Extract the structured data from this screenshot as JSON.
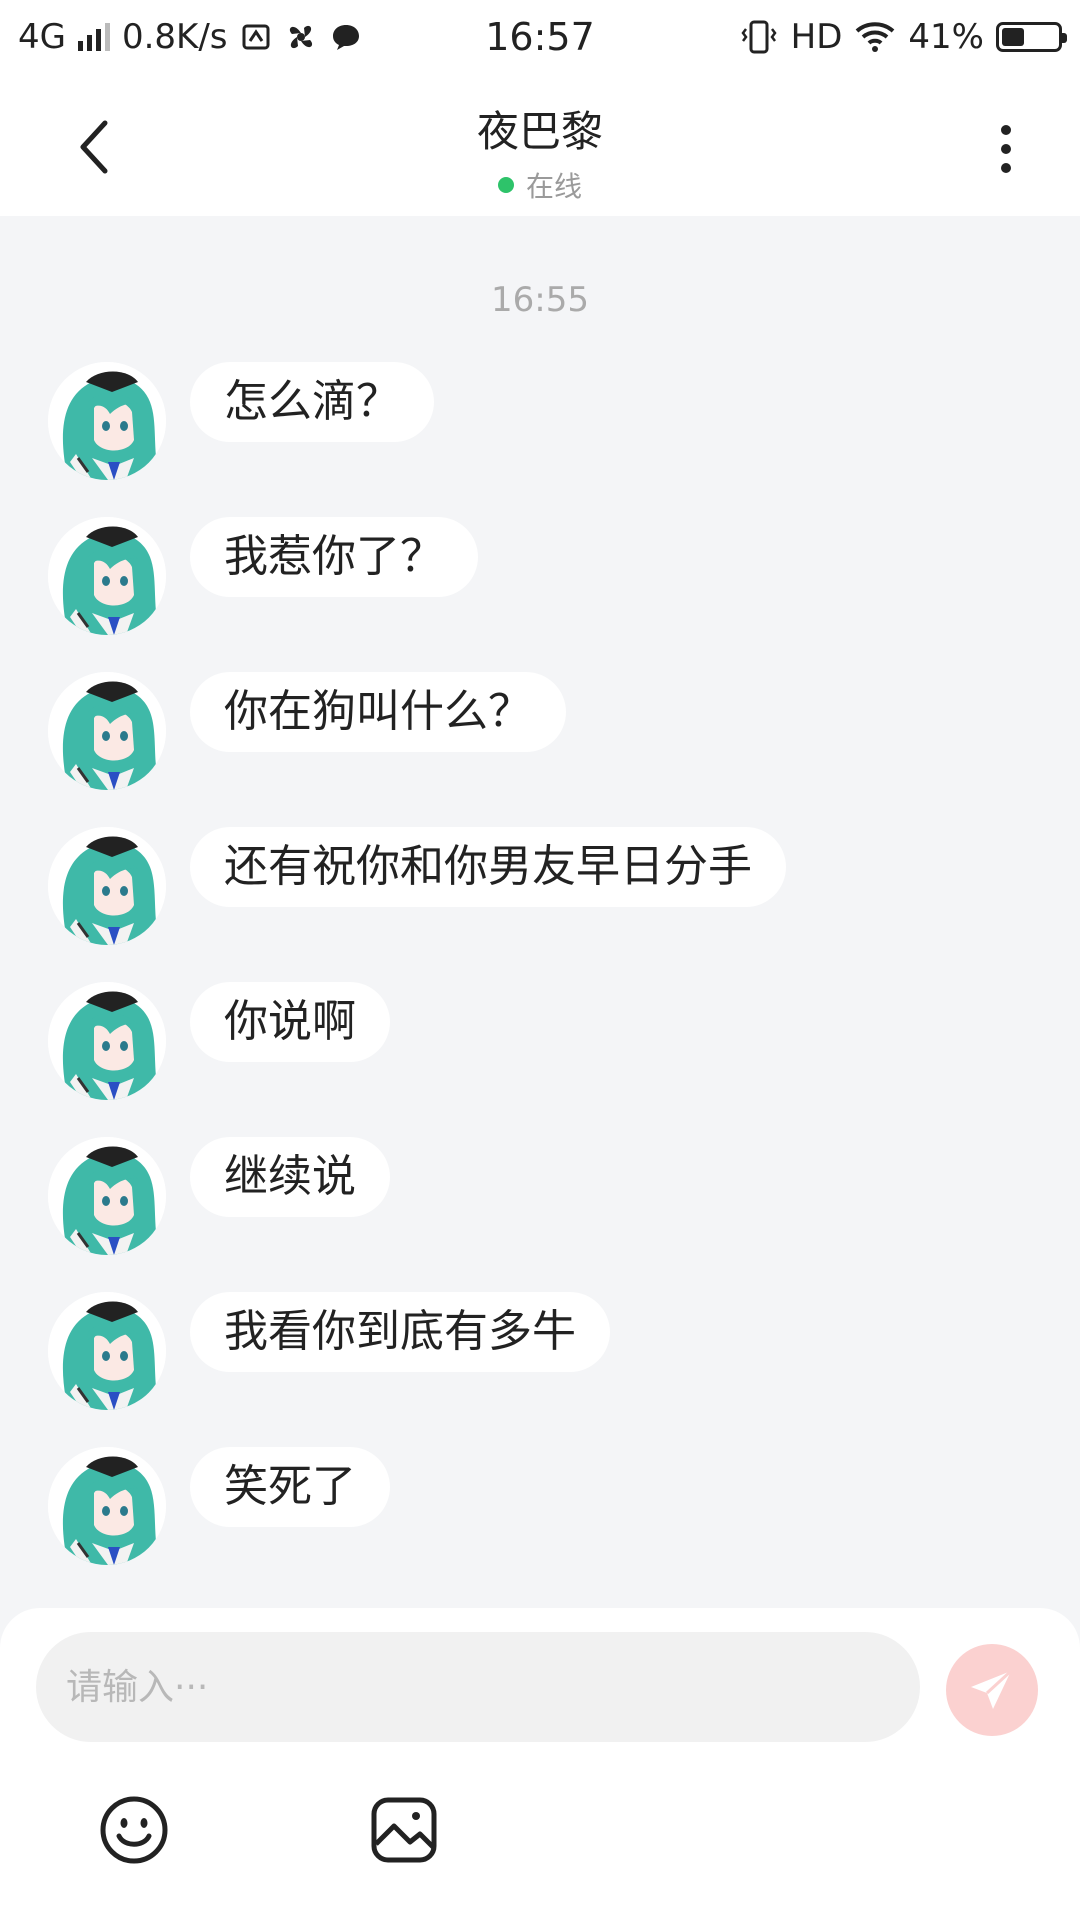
{
  "status_bar": {
    "network": "4G",
    "speed": "0.8K/s",
    "time": "16:57",
    "hd": "HD",
    "battery_percent": "41%",
    "battery_level": 0.41,
    "icons": [
      "signal-icon",
      "nfc-icon",
      "fan-icon",
      "message-icon",
      "vibrate-icon",
      "wifi-icon",
      "battery-icon"
    ]
  },
  "header": {
    "title": "夜巴黎",
    "status": "在线",
    "online_color": "#2ec36a"
  },
  "chat": {
    "timestamp": "16:55",
    "messages": [
      {
        "text": "怎么滴？"
      },
      {
        "text": "我惹你了？"
      },
      {
        "text": "你在狗叫什么？"
      },
      {
        "text": "还有祝你和你男友早日分手"
      },
      {
        "text": "你说啊"
      },
      {
        "text": "继续说"
      },
      {
        "text": "我看你到底有多牛"
      },
      {
        "text": "笑死了"
      }
    ]
  },
  "input": {
    "placeholder": "请输入···",
    "send_color": "#fbd1d0",
    "icons": [
      "emoji-icon",
      "image-icon",
      "send-icon"
    ]
  },
  "colors": {
    "background": "#f4f5f7",
    "bubble": "#ffffff",
    "avatar_hair": "#3fb9a8"
  }
}
